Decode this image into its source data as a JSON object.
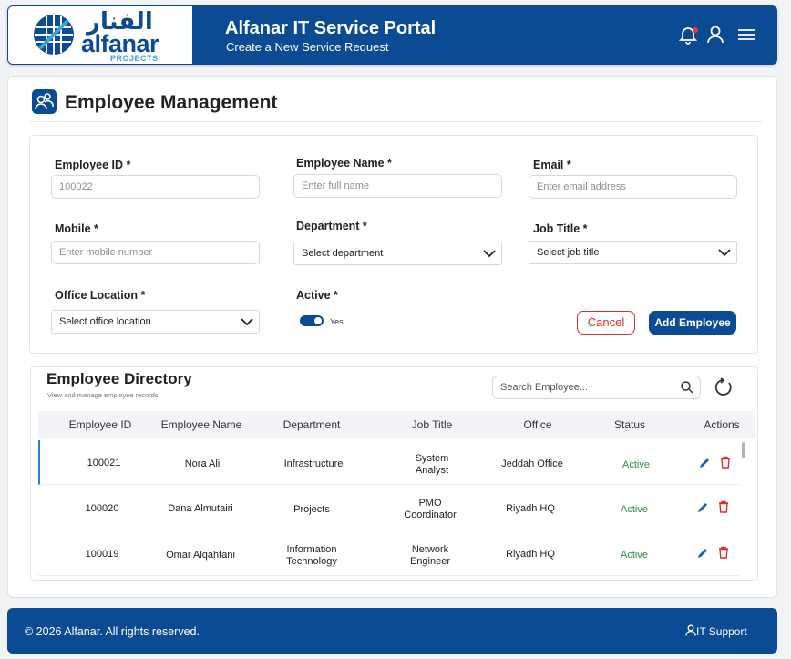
{
  "header": {
    "logo_arabic": "الفنار",
    "logo_latin": "alfanar",
    "logo_projects": "PROJECTS",
    "title": "Alfanar IT Service Portal",
    "subtitle": "Create a New Service Request",
    "icons": [
      "bell-icon",
      "user-icon",
      "menu-icon"
    ]
  },
  "section": {
    "title": "Employee Management",
    "icon": "users-icon"
  },
  "form": {
    "employee_id": {
      "label": "Employee ID *",
      "value": "100022"
    },
    "employee_name": {
      "label": "Employee Name *",
      "placeholder": "Enter full name"
    },
    "email": {
      "label": "Email *",
      "placeholder": "Enter email address"
    },
    "mobile": {
      "label": "Mobile *",
      "placeholder": "Enter mobile number"
    },
    "department": {
      "label": "Department *",
      "value": "Select department"
    },
    "job_title": {
      "label": "Job Title *",
      "value": "Select job title"
    },
    "office_location": {
      "label": "Office Location *",
      "value": "Select office location"
    },
    "active": {
      "label": "Active *",
      "value": "Yes",
      "on": true
    },
    "cancel_label": "Cancel",
    "add_label": "Add Employee"
  },
  "directory": {
    "title": "Employee Directory",
    "subtitle": "View and manage employee records",
    "search_placeholder": "Search Employee...",
    "columns": [
      "Employee ID",
      "Employee Name",
      "Department",
      "Job Title",
      "Office",
      "Status",
      "Actions"
    ],
    "rows": [
      {
        "id": "100021",
        "name": "Nora Ali",
        "dept": [
          "Infrastructure"
        ],
        "title": [
          "System",
          "Analyst"
        ],
        "office": "Jeddah Office",
        "status": "Active"
      },
      {
        "id": "100020",
        "name": "Dana Almutairi",
        "dept": [
          "Projects"
        ],
        "title": [
          "PMO",
          "Coordinator"
        ],
        "office": "Riyadh HQ",
        "status": "Active"
      },
      {
        "id": "100019",
        "name": "Omar Alqahtani",
        "dept": [
          "Information",
          "Technology"
        ],
        "title": [
          "Network",
          "Engineer"
        ],
        "office": "Riyadh HQ",
        "status": "Active"
      }
    ]
  },
  "footer": {
    "copyright": "© 2026 Alfanar. All rights reserved.",
    "support": "IT Support"
  },
  "colors": {
    "brand": "#0b4b94",
    "danger": "#d9302c",
    "active": "#2e8b47"
  }
}
